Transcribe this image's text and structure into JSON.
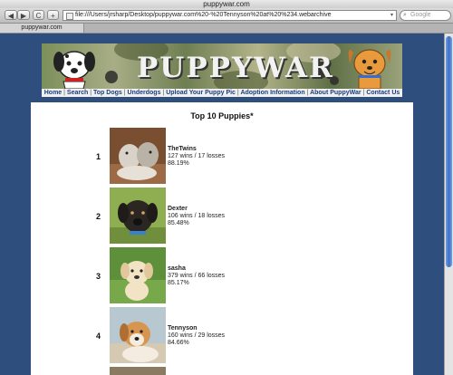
{
  "window": {
    "title": "puppywar.com"
  },
  "toolbar": {
    "back_label": "◀",
    "forward_label": "▶",
    "reload_label": "C",
    "add_label": "+",
    "url": "file:///Users/jrsharp/Desktop/puppywar.com%20-%20Tennyson%20at%20%234.webarchive",
    "search_placeholder": "Google"
  },
  "tab": {
    "label": "puppywar.com"
  },
  "site": {
    "banner_title": "PUPPYWAR",
    "nav": [
      "Home",
      "Search",
      "Top Dogs",
      "Underdogs",
      "Upload Your Puppy Pic",
      "Adoption Information",
      "About PuppyWar",
      "Contact Us"
    ]
  },
  "main": {
    "heading": "Top 10 Puppies*",
    "puppies": [
      {
        "rank": "1",
        "name": "TheTwins",
        "record": "127 wins / 17 losses",
        "pct": "88.19%"
      },
      {
        "rank": "2",
        "name": "Dexter",
        "record": "106 wins / 18 losses",
        "pct": "85.48%"
      },
      {
        "rank": "3",
        "name": "sasha",
        "record": "379 wins / 66 losses",
        "pct": "85.17%"
      },
      {
        "rank": "4",
        "name": "Tennyson",
        "record": "160 wins / 29 losses",
        "pct": "84.66%"
      }
    ]
  },
  "colors": {
    "page_bg": "#2e4f7d",
    "nav_text": "#1a3d7c",
    "scroll_thumb": "#3d6fc4"
  }
}
